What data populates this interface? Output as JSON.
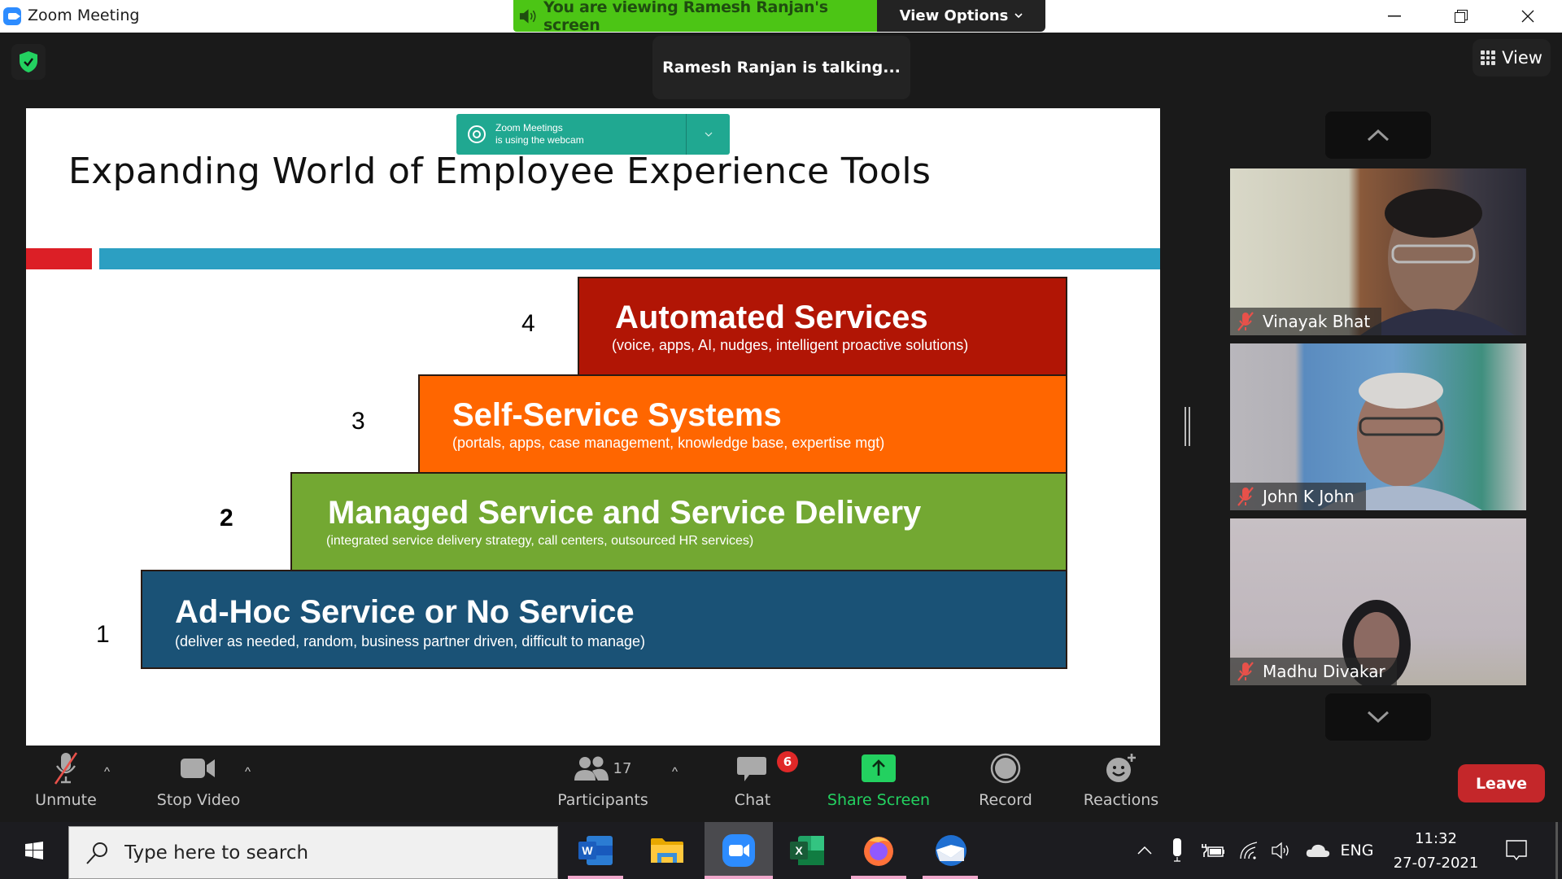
{
  "window": {
    "title": "Zoom Meeting",
    "controls": [
      "minimize",
      "restore",
      "close"
    ]
  },
  "share_banner": {
    "text": "You are viewing Ramesh Ranjan's screen",
    "view_options_label": "View Options",
    "color": "#4cc515"
  },
  "talking_toast": "Ramesh Ranjan is talking...",
  "view_button_label": "View",
  "webcam_notice": {
    "line1": "Zoom Meetings",
    "line2": "is using the webcam"
  },
  "slide": {
    "title": "Expanding World of Employee Experience Tools",
    "steps": [
      {
        "number": "4",
        "heading": "Automated Services",
        "sub": "(voice, apps, AI, nudges, intelligent proactive solutions)",
        "color": "#b11505"
      },
      {
        "number": "3",
        "heading": "Self-Service Systems",
        "sub": "(portals, apps, case management, knowledge base, expertise mgt)",
        "color": "#ff6600"
      },
      {
        "number": "2",
        "heading": "Managed Service and Service Delivery",
        "sub": "(integrated service delivery strategy, call centers, outsourced HR services)",
        "color": "#73a832"
      },
      {
        "number": "1",
        "heading": "Ad-Hoc Service or No Service",
        "sub": "(deliver as needed, random, business partner driven, difficult to manage)",
        "color": "#1a5276"
      }
    ]
  },
  "participants_gallery": [
    {
      "name": "Vinayak Bhat",
      "muted": true
    },
    {
      "name": "John K John",
      "muted": true
    },
    {
      "name": "Madhu Divakar",
      "muted": true
    }
  ],
  "toolbar": {
    "unmute": "Unmute",
    "stop_video": "Stop Video",
    "participants": "Participants",
    "participants_count": "17",
    "chat": "Chat",
    "chat_badge": "6",
    "share_screen": "Share Screen",
    "record": "Record",
    "reactions": "Reactions",
    "leave": "Leave"
  },
  "taskbar": {
    "search_placeholder": "Type here to search",
    "apps": [
      "word-icon",
      "file-explorer-icon",
      "zoom-icon",
      "excel-icon",
      "firefox-icon",
      "thunderbird-icon"
    ],
    "language": "ENG",
    "time": "11:32",
    "date": "27-07-2021"
  }
}
